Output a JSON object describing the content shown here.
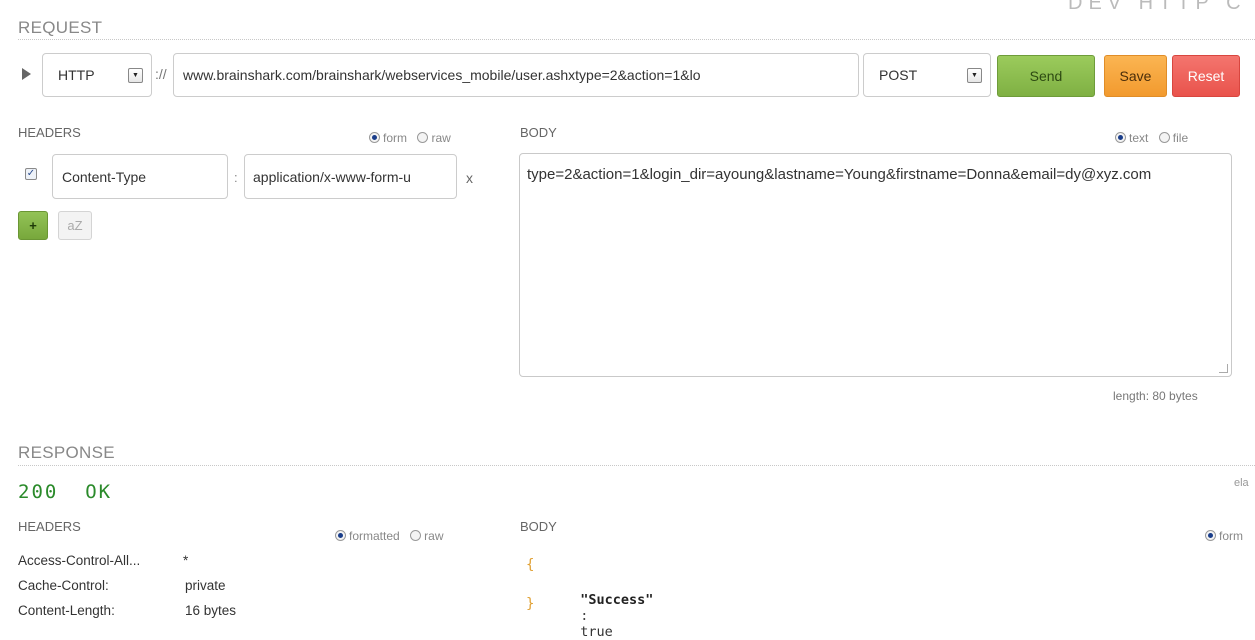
{
  "header": {
    "partial_title": "DEV HTTP C"
  },
  "request": {
    "section_title": "REQUEST",
    "protocol": "HTTP",
    "separator": "://",
    "url": "www.brainshark.com/brainshark/webservices_mobile/user.ashxtype=2&action=1&lo",
    "method": "POST",
    "send_label": "Send",
    "save_label": "Save",
    "reset_label": "Reset",
    "headers": {
      "title": "HEADERS",
      "mode_form": "form",
      "mode_raw": "raw",
      "selected_mode": "form",
      "rows": [
        {
          "checked": true,
          "name": "Content-Type",
          "colon": ":",
          "value": "application/x-www-form-u",
          "remove": "x"
        }
      ],
      "add_label": "+",
      "sort_label": "aZ"
    },
    "body": {
      "title": "BODY",
      "mode_text": "text",
      "mode_file": "file",
      "selected_mode": "text",
      "content": "type=2&action=1&login_dir=ayoung&lastname=Young&firstname=Donna&email=dy@xyz.com",
      "length": "length: 80 bytes"
    }
  },
  "response": {
    "section_title": "RESPONSE",
    "status": "200  OK",
    "elapsed_partial": "ela",
    "headers": {
      "title": "HEADERS",
      "mode_formatted": "formatted",
      "mode_raw": "raw",
      "selected_mode": "formatted",
      "rows": [
        {
          "name": "Access-Control-All...",
          "value": "*"
        },
        {
          "name": "Cache-Control:",
          "value": "private"
        },
        {
          "name": "Content-Length:",
          "value": "16 bytes"
        }
      ]
    },
    "body": {
      "title": "BODY",
      "mode_partial": "form",
      "open_brace": "{",
      "key": "\"Success\"",
      "colon": ":",
      "value": "true",
      "close_brace": "}"
    }
  },
  "colors": {
    "send": "#86b94a",
    "save": "#f6a23a",
    "reset": "#ee5c55",
    "status_ok": "#2a8a2a",
    "json_brace": "#e0a033",
    "add_button": "#7fb043"
  }
}
